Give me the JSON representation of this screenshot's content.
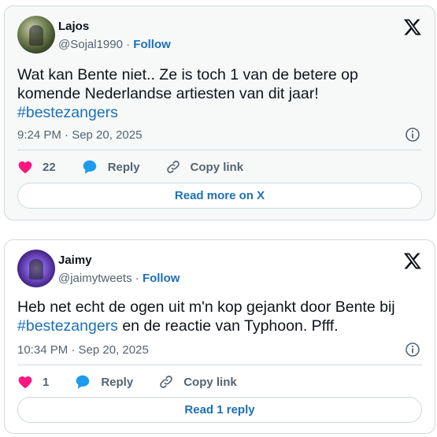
{
  "tweets": [
    {
      "author_name": "Lajos",
      "handle": "@Sojal1990",
      "separator": " · ",
      "follow_label": "Follow",
      "text_main": "Wat kan Bente niet.. Ze is toch 1 van de betere op komende Nederlandse artiesten van dit jaar!",
      "hashtag": "#bestezangers",
      "timestamp": "9:24 PM · Sep 20, 2025",
      "like_count": "22",
      "reply_label": "Reply",
      "copy_link_label": "Copy link",
      "bottom_button_label": "Read more on X"
    },
    {
      "author_name": "Jaimy",
      "handle": "@jaimytweets",
      "separator": " · ",
      "follow_label": "Follow",
      "text_before": "Heb net echt de ogen uit m'n kop gejankt door Bente bij ",
      "hashtag": "#bestezangers",
      "text_after": " en de reactie van Typhoon. Pfff.",
      "timestamp": "10:34 PM · Sep 20, 2025",
      "like_count": "1",
      "reply_label": "Reply",
      "copy_link_label": "Copy link",
      "bottom_button_label": "Read 1 reply"
    }
  ],
  "colors": {
    "link": "#1d6fb8",
    "like_heart": "#f91880",
    "reply_bubble": "#1d9bf0",
    "muted_text": "#536471",
    "border": "#cfd9de"
  },
  "icons": [
    "x-logo-icon",
    "info-icon",
    "heart-icon",
    "reply-bubble-icon",
    "link-icon"
  ]
}
